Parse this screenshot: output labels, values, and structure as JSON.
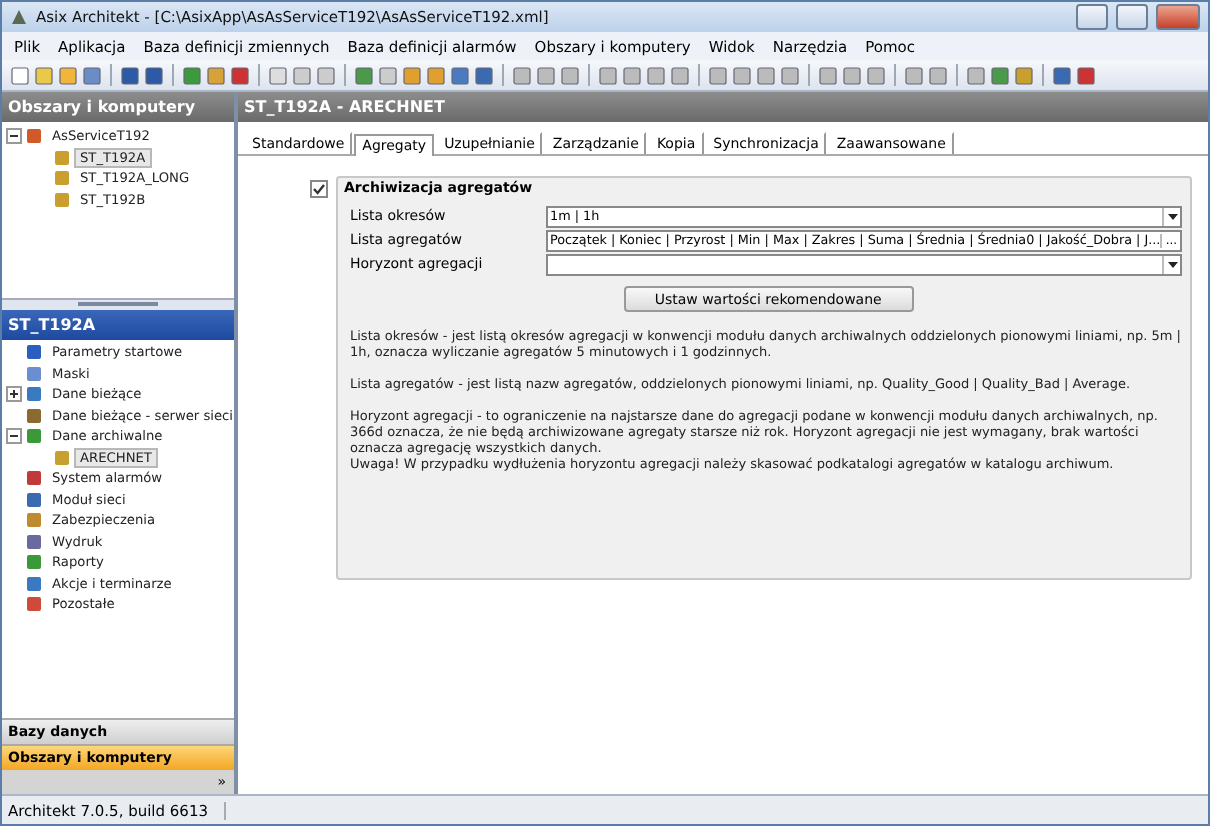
{
  "window": {
    "title": "Asix Architekt - [C:\\AsixApp\\AsAsServiceT192\\AsAsServiceT192.xml]"
  },
  "menu": [
    "Plik",
    "Aplikacja",
    "Baza definicji zmiennych",
    "Baza definicji alarmów",
    "Obszary i komputery",
    "Widok",
    "Narzędzia",
    "Pomoc"
  ],
  "left_panel": {
    "title": "Obszary i komputery",
    "tree": [
      {
        "label": "AsServiceT192",
        "expanded": true,
        "children": [
          {
            "label": "ST_T192A",
            "selected": true
          },
          {
            "label": "ST_T192A_LONG",
            "selected": false
          },
          {
            "label": "ST_T192B",
            "selected": false
          }
        ]
      }
    ],
    "section": {
      "title": "ST_T192A",
      "items": [
        {
          "label": "Parametry startowe",
          "selected": false
        },
        {
          "label": "Maski",
          "selected": false
        },
        {
          "label": "Dane bieżące",
          "expanded": false,
          "selected": false
        },
        {
          "label": "Dane bieżące - serwer sieci",
          "selected": false
        },
        {
          "label": "Dane archiwalne",
          "expanded": true,
          "selected": false,
          "children": [
            {
              "label": "ARECHNET",
              "selected": true
            }
          ]
        },
        {
          "label": "System alarmów",
          "selected": false
        },
        {
          "label": "Moduł sieci",
          "selected": false
        },
        {
          "label": "Zabezpieczenia",
          "selected": false
        },
        {
          "label": "Wydruk",
          "selected": false
        },
        {
          "label": "Raporty",
          "selected": false
        },
        {
          "label": "Akcje i terminarze",
          "selected": false
        },
        {
          "label": "Pozostałe",
          "selected": false
        }
      ]
    },
    "nav_buttons": [
      {
        "label": "Bazy danych",
        "selected": false
      },
      {
        "label": "Obszary i komputery",
        "selected": true
      }
    ],
    "more": "»"
  },
  "content": {
    "title": "ST_T192A - ARECHNET",
    "tabs": [
      {
        "label": "Standardowe",
        "selected": false
      },
      {
        "label": "Agregaty",
        "selected": true
      },
      {
        "label": "Uzupełnianie",
        "selected": false
      },
      {
        "label": "Zarządzanie",
        "selected": false
      },
      {
        "label": "Kopia",
        "selected": false
      },
      {
        "label": "Synchronizacja",
        "selected": false
      },
      {
        "label": "Zaawansowane",
        "selected": false
      }
    ],
    "group": {
      "label": "Archiwizacja agregatów",
      "checked": true,
      "fields": [
        {
          "label": "Lista okresów",
          "value": "1m | 1h",
          "kind": "dropdown"
        },
        {
          "label": "Lista agregatów",
          "value": "Początek | Koniec | Przyrost | Min | Max | Zakres | Suma | Średnia | Średnia0 | Jakość_Dobra | J...",
          "kind": "browse",
          "button": "..."
        },
        {
          "label": "Horyzont agregacji",
          "kind": "dropdown"
        }
      ],
      "button": "Ustaw wartości rekomendowane",
      "help": [
        "Lista okresów - jest listą okresów agregacji w konwencji modułu danych archiwalnych oddzielonych pionowymi liniami, np. 5m | 1h, oznacza wyliczanie agregatów 5 minutowych i 1 godzinnych.",
        "Lista agregatów - jest listą nazw agregatów, oddzielonych pionowymi liniami, np. Quality_Good | Quality_Bad | Average.",
        "Horyzont agregacji - to ograniczenie na najstarsze dane do agregacji podane w konwencji modułu danych archiwalnych, np. 366d oznacza, że nie będą archiwizowane agregaty starsze niż rok. Horyzont agregacji nie jest wymagany, brak wartości oznacza agregację wszystkich danych.\nUwaga! W przypadku wydłużenia horyzontu agregacji należy skasować podkatalogi agregatów w katalogu archiwum."
      ]
    }
  },
  "status_bar": "Architekt 7.0.5, build 6613"
}
